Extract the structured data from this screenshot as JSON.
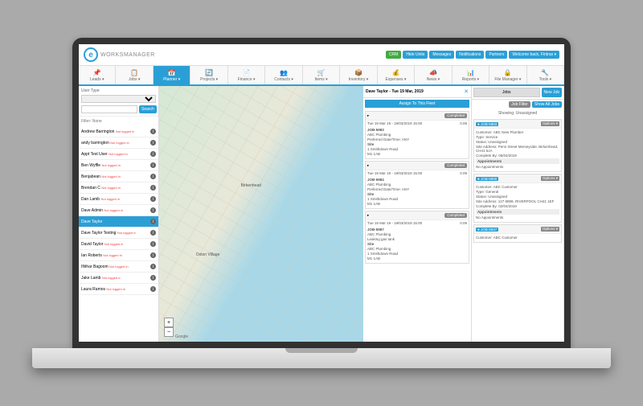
{
  "brand": {
    "mark": "e",
    "text": "WORKSMANAGER"
  },
  "topButtons": {
    "crm": "CRM",
    "hideUnits": "Hide Units",
    "messages": "Messages",
    "notifications": "Notifications",
    "partners": "Partners",
    "welcome": "Welcome back, Fintrax ▾"
  },
  "nav": [
    {
      "l": "Leads ▾",
      "i": "📌"
    },
    {
      "l": "Jobs ▾",
      "i": "📋"
    },
    {
      "l": "Planner ▾",
      "i": "📅"
    },
    {
      "l": "Projects ▾",
      "i": "🔄"
    },
    {
      "l": "Finance ▾",
      "i": "📄"
    },
    {
      "l": "Contacts ▾",
      "i": "👥"
    },
    {
      "l": "Items ▾",
      "i": "🛒"
    },
    {
      "l": "Inventory ▾",
      "i": "📦"
    },
    {
      "l": "Expenses ▾",
      "i": "💰"
    },
    {
      "l": "News ▾",
      "i": "📣"
    },
    {
      "l": "Reports ▾",
      "i": "📊"
    },
    {
      "l": "File Manager ▾",
      "i": "🔒"
    },
    {
      "l": "Tools ▾",
      "i": "🔧"
    }
  ],
  "activeNav": 2,
  "userList": {
    "typeLabel": "User Type",
    "typeValue": "",
    "searchBtn": "Search",
    "filterLabel": "Filter: None",
    "users": [
      {
        "n": "Andrew Barrington",
        "s": "Not logged in"
      },
      {
        "n": "andy barrington",
        "s": "Not logged in"
      },
      {
        "n": "Appt Test User",
        "s": "Not logged in"
      },
      {
        "n": "Ben Wyffle",
        "s": "Not logged in"
      },
      {
        "n": "Benjabean",
        "s": "Not logged in"
      },
      {
        "n": "Brendan C",
        "s": "Not logged in"
      },
      {
        "n": "Dan Lamb",
        "s": "Not logged in"
      },
      {
        "n": "Dave Admin",
        "s": "Not logged in"
      },
      {
        "n": "Dave Taylor",
        "s": ""
      },
      {
        "n": "Dave Taylor Testing",
        "s": "Not logged in"
      },
      {
        "n": "David Taylor",
        "s": "Not logged in"
      },
      {
        "n": "Ian Roberts",
        "s": "Not logged in"
      },
      {
        "n": "Ifiithar Bagoom",
        "s": "Not logged in"
      },
      {
        "n": "Jake Lamb",
        "s": "Not logged in"
      },
      {
        "n": "Laura Ramos",
        "s": "Not logged in"
      }
    ],
    "selectedIndex": 8
  },
  "map": {
    "label1": "Birkenhead",
    "label2": "Oxton Village",
    "google": "Google"
  },
  "mid": {
    "title": "Dave Taylor - Tue 19 Mar, 2019",
    "assign": "Assign To This Fleet",
    "jobs": [
      {
        "status": "Completed",
        "date": "Tue 19 Mar 19 - 19/03/2019 15:00",
        "time": "0.08",
        "id": "JOB-5983",
        "cust": "ABC Plumbing",
        "pref": "Preferred Date/Time: ANY",
        "siteL": "Site",
        "addr1": "1 Smithdown Road",
        "addr2": "M1 1AB"
      },
      {
        "status": "Completed",
        "date": "Tue 19 Mar 19 - 19/03/2019 15:00",
        "time": "0.09",
        "id": "JOB-5984",
        "cust": "ABC Plumbing",
        "pref": "Preferred Date/Time: ANY",
        "siteL": "Site",
        "addr1": "1 Smithdown Road",
        "addr2": "M1 1AB"
      },
      {
        "status": "Completed",
        "date": "Tue 19 Mar 19 - 19/03/2019 15:00",
        "time": "0.09",
        "id": "JOB-5987",
        "cust": "ABC Plumbing",
        "desc": "Leaking gas tank",
        "siteL": "Site",
        "site": "ABC Plumbing",
        "addr1": "1 Smithdown Road",
        "addr2": "M1 1AB"
      }
    ]
  },
  "right": {
    "tabJobs": "Jobs",
    "btnNewJob": "New Job",
    "btnFilter": "Job Filter",
    "btnShowAll": "Show All Jobs",
    "showing": "Showing: Unassigned",
    "cards": [
      {
        "id": "JOB-5983",
        "opt": "Options ▾",
        "cust": "Customer: ABC New Plumber",
        "type": "Type: Service",
        "status": "Status: Unassigned",
        "addr": "Site Address: Penn Street Merseyside, Birkenhead, CH41 5JA",
        "comp": "Complete By: 05/04/2019",
        "appH": "Appointments",
        "apps": "No Appointments"
      },
      {
        "id": "JOB-5890",
        "opt": "Options ▾",
        "cust": "Customer: ABC Customer",
        "type": "Type: General",
        "status": "Status: Unassigned",
        "addr": "Site Address: 127 8899, RIVERPOOL CH41 1EF",
        "comp": "Complete By: 02/04/2019",
        "appH": "Appointments",
        "apps": "No Appointments"
      },
      {
        "id": "JOB-5847",
        "opt": "Options ▾",
        "cust": "Customer: ABC Customer"
      }
    ]
  }
}
